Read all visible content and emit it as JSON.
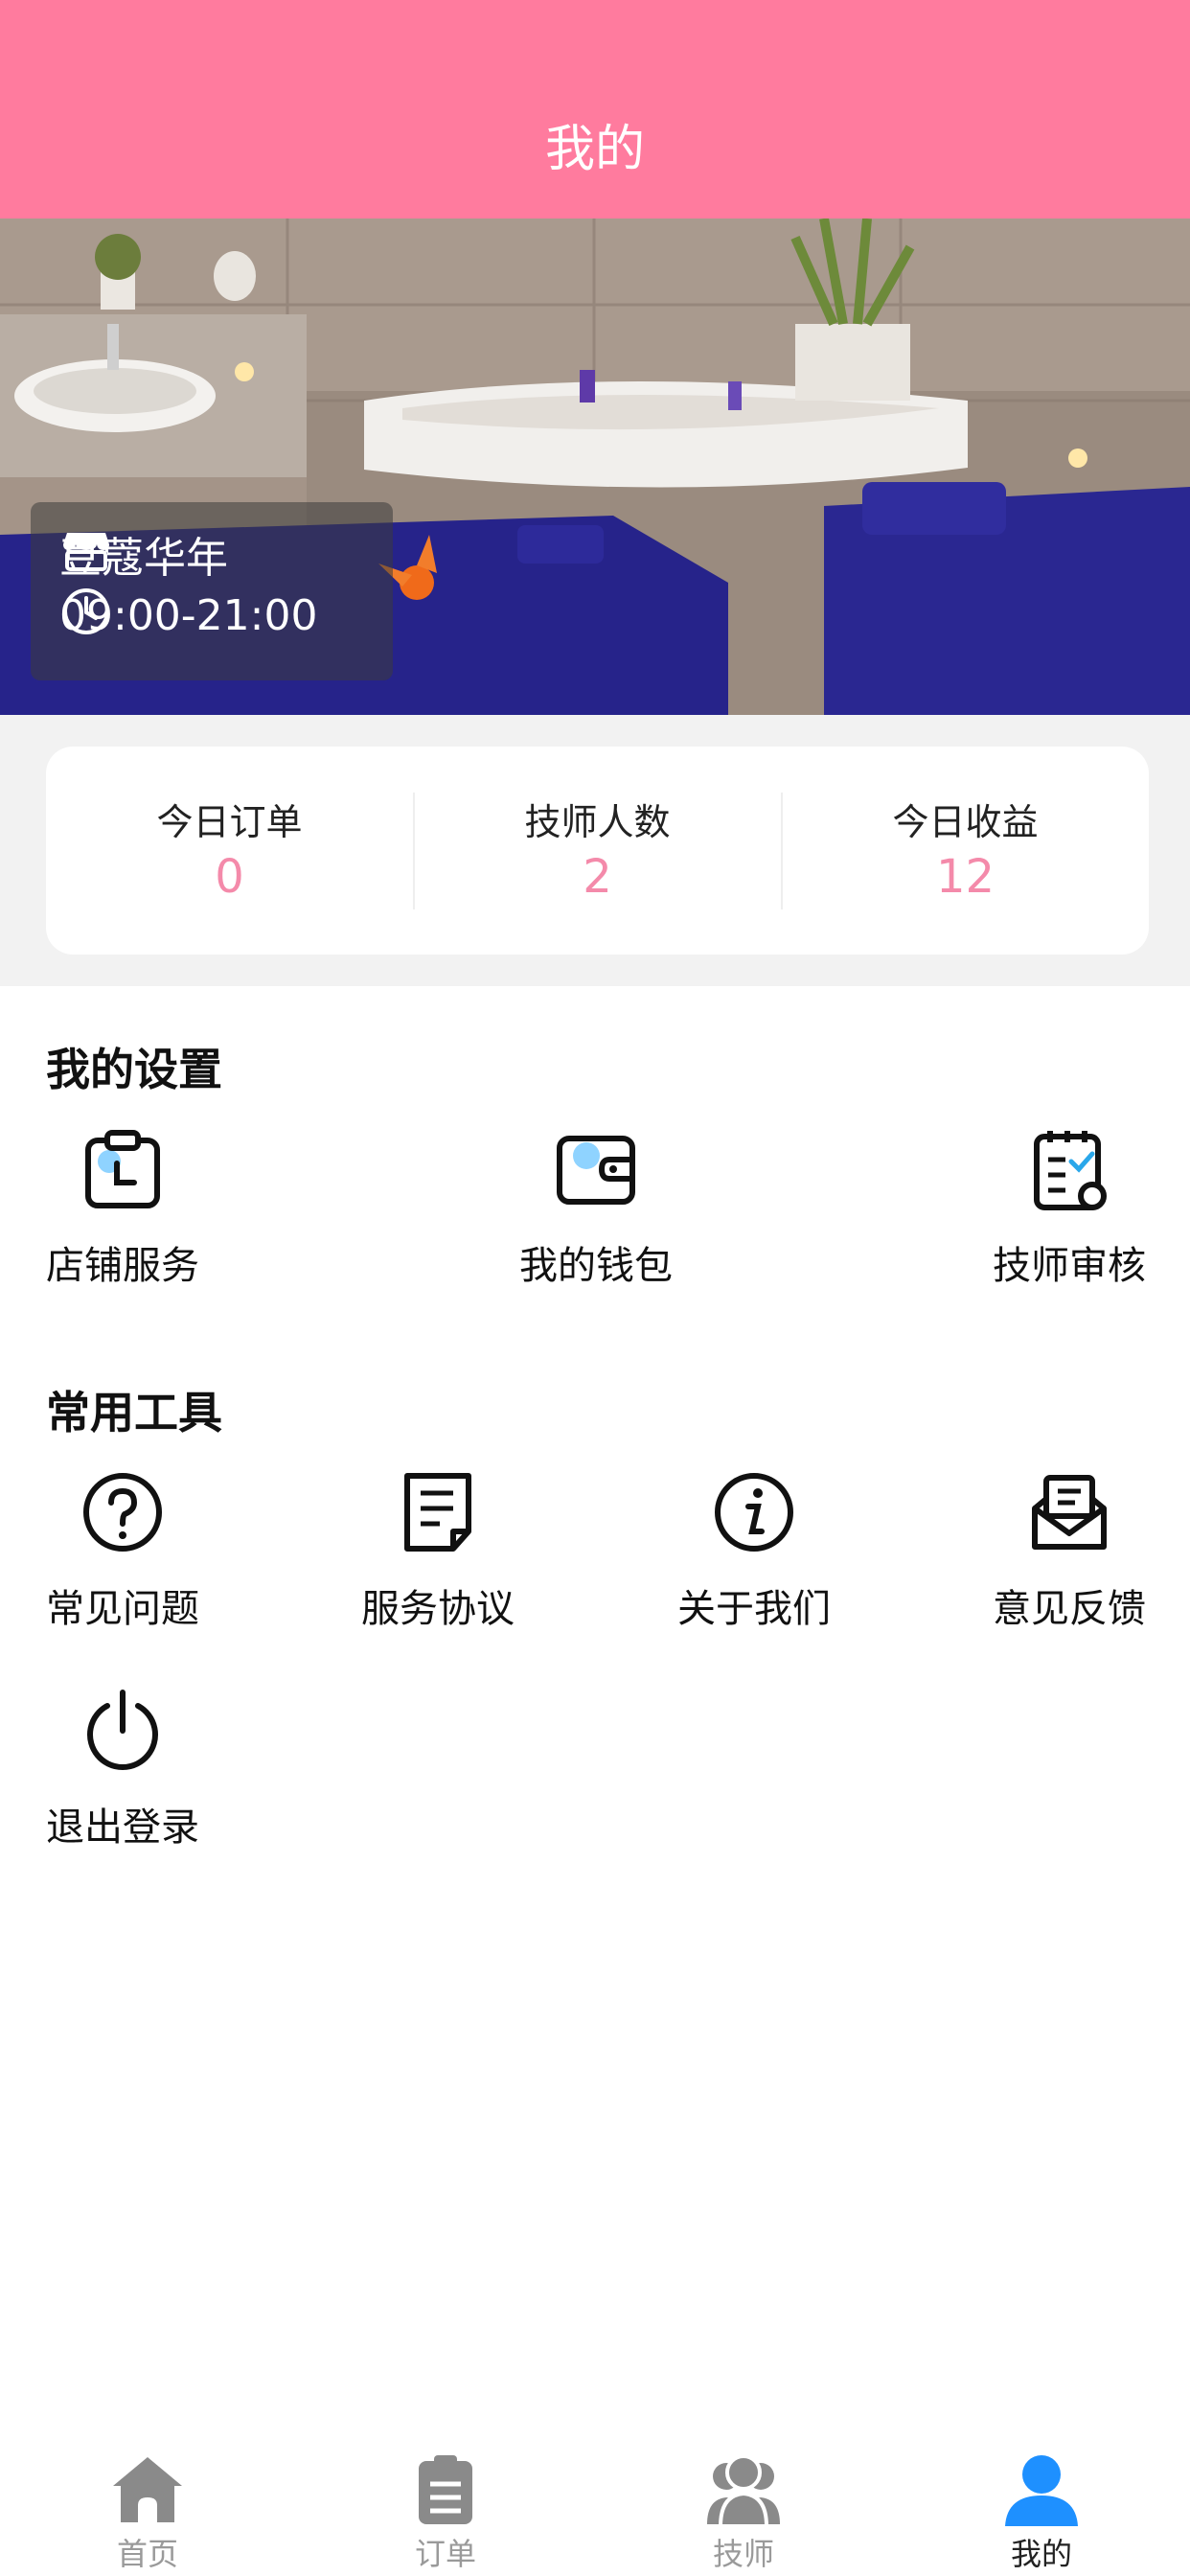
{
  "header": {
    "title": "我的"
  },
  "shop": {
    "name": "豆蔻华年",
    "hours": "09:00-21:00"
  },
  "stats": [
    {
      "label": "今日订单",
      "value": "0"
    },
    {
      "label": "技师人数",
      "value": "2"
    },
    {
      "label": "今日收益",
      "value": "12"
    }
  ],
  "settings": {
    "title": "我的设置",
    "items": [
      {
        "label": "店铺服务",
        "icon": "clipboard-clock-icon"
      },
      {
        "label": "我的钱包",
        "icon": "wallet-icon"
      },
      {
        "label": "技师审核",
        "icon": "checklist-icon"
      }
    ]
  },
  "tools": {
    "title": "常用工具",
    "items": [
      {
        "label": "常见问题",
        "icon": "question-icon"
      },
      {
        "label": "服务协议",
        "icon": "document-icon"
      },
      {
        "label": "关于我们",
        "icon": "info-icon"
      },
      {
        "label": "意见反馈",
        "icon": "feedback-envelope-icon"
      },
      {
        "label": "退出登录",
        "icon": "power-icon"
      }
    ]
  },
  "tabbar": {
    "items": [
      {
        "label": "首页",
        "icon": "home-icon"
      },
      {
        "label": "订单",
        "icon": "orders-icon"
      },
      {
        "label": "技师",
        "icon": "technicians-icon"
      },
      {
        "label": "我的",
        "icon": "user-icon",
        "active": true
      }
    ]
  },
  "colors": {
    "brand": "#FF7B9E",
    "stat_value": "#F48AAA",
    "active_tab": "#1E90FF",
    "inactive_tab": "#9a9a9a",
    "icon_accent": "#8FD3FF"
  }
}
